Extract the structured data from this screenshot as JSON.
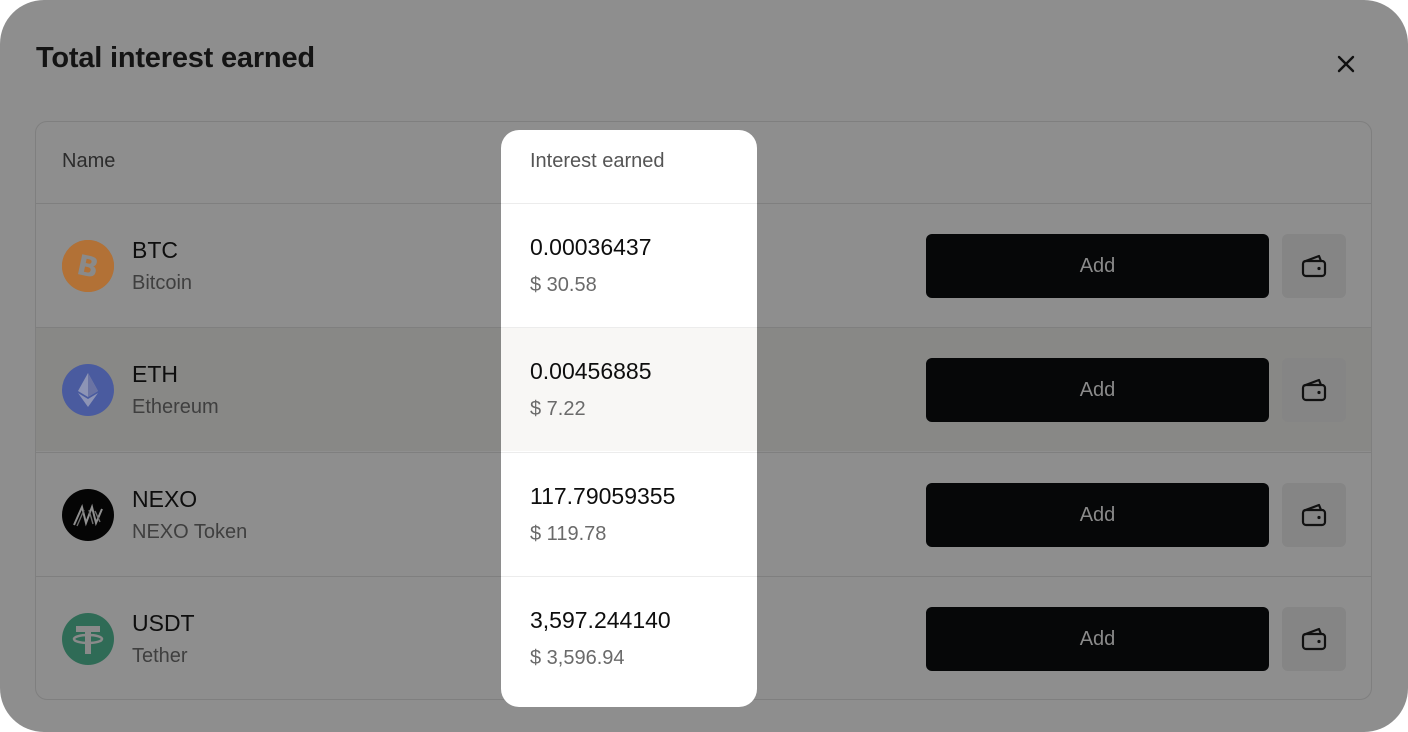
{
  "modal": {
    "title": "Total interest earned",
    "close_icon": "close-icon"
  },
  "table": {
    "headers": {
      "name": "Name",
      "interest": "Interest earned"
    },
    "rows": [
      {
        "symbol": "BTC",
        "name": "Bitcoin",
        "icon": "bitcoin-icon",
        "icon_color": "#f7931a",
        "amount": "0.00036437",
        "usd": "$ 30.58",
        "add_label": "Add",
        "wallet_icon": "wallet-icon"
      },
      {
        "symbol": "ETH",
        "name": "Ethereum",
        "icon": "ethereum-icon",
        "icon_color": "#627eea",
        "amount": "0.00456885",
        "usd": "$ 7.22",
        "add_label": "Add",
        "wallet_icon": "wallet-icon"
      },
      {
        "symbol": "NEXO",
        "name": "NEXO Token",
        "icon": "nexo-icon",
        "icon_color": "#000000",
        "amount": "117.79059355",
        "usd": "$ 119.78",
        "add_label": "Add",
        "wallet_icon": "wallet-icon"
      },
      {
        "symbol": "USDT",
        "name": "Tether",
        "icon": "tether-icon",
        "icon_color": "#26a17b",
        "amount": "3,597.244140",
        "usd": "$ 3,596.94",
        "add_label": "Add",
        "wallet_icon": "wallet-icon"
      }
    ]
  },
  "colors": {
    "overlay_dim": "#8e8e8e",
    "button_bg": "#060708",
    "highlight_bg": "#ffffff"
  }
}
